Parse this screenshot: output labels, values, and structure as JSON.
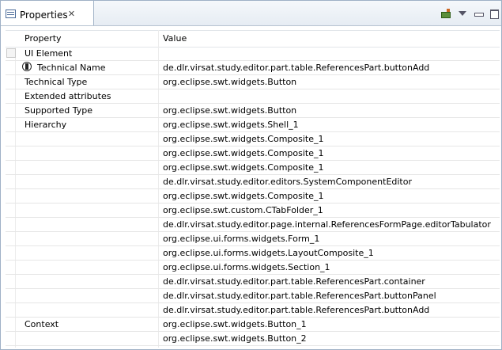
{
  "view": {
    "title": "Properties"
  },
  "columns": {
    "property": "Property",
    "value": "Value"
  },
  "rows": [
    {
      "property": "UI Element",
      "value": ""
    },
    {
      "property": "Technical Name",
      "value": "de.dlr.virsat.study.editor.part.table.ReferencesPart.buttonAdd"
    },
    {
      "property": "Technical Type",
      "value": "org.eclipse.swt.widgets.Button"
    },
    {
      "property": "Extended attributes",
      "value": ""
    },
    {
      "property": "Supported Type",
      "value": "org.eclipse.swt.widgets.Button"
    },
    {
      "property": "Hierarchy",
      "value": "org.eclipse.swt.widgets.Shell_1"
    },
    {
      "property": "",
      "value": "org.eclipse.swt.widgets.Composite_1"
    },
    {
      "property": "",
      "value": "org.eclipse.swt.widgets.Composite_1"
    },
    {
      "property": "",
      "value": "org.eclipse.swt.widgets.Composite_1"
    },
    {
      "property": "",
      "value": "de.dlr.virsat.study.editor.editors.SystemComponentEditor"
    },
    {
      "property": "",
      "value": "org.eclipse.swt.widgets.Composite_1"
    },
    {
      "property": "",
      "value": "org.eclipse.swt.custom.CTabFolder_1"
    },
    {
      "property": "",
      "value": "de.dlr.virsat.study.editor.page.internal.ReferencesFormPage.editorTabulator"
    },
    {
      "property": "",
      "value": "org.eclipse.ui.forms.widgets.Form_1"
    },
    {
      "property": "",
      "value": "org.eclipse.ui.forms.widgets.LayoutComposite_1"
    },
    {
      "property": "",
      "value": "org.eclipse.ui.forms.widgets.Section_1"
    },
    {
      "property": "",
      "value": "de.dlr.virsat.study.editor.part.table.ReferencesPart.container"
    },
    {
      "property": "",
      "value": "de.dlr.virsat.study.editor.part.table.ReferencesPart.buttonPanel"
    },
    {
      "property": "",
      "value": "de.dlr.virsat.study.editor.part.table.ReferencesPart.buttonAdd"
    },
    {
      "property": "Context",
      "value": "org.eclipse.swt.widgets.Button_1"
    },
    {
      "property": "",
      "value": "org.eclipse.swt.widgets.Button_2"
    }
  ]
}
